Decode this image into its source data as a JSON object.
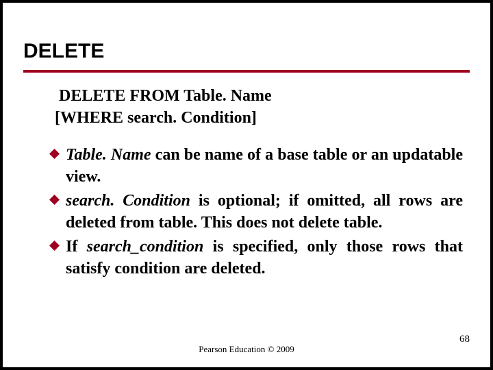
{
  "title": "DELETE",
  "code": {
    "line1": "DELETE FROM Table. Name",
    "line2": "[WHERE search. Condition]"
  },
  "bullets": [
    {
      "lead_italic": "Table. Name",
      "rest": " can be name of a base table or an updatable view."
    },
    {
      "lead_italic": "search. Condition",
      "rest": " is optional; if omitted, all rows are deleted from table. This does not delete table."
    },
    {
      "lead_plain": "If ",
      "mid_italic": "search_condition",
      "rest": " is specified, only those rows that satisfy condition are deleted."
    }
  ],
  "footer": "Pearson Education © 2009",
  "page": "68",
  "colors": {
    "rule": "#a00020",
    "bullet_fill": "#a00020"
  }
}
